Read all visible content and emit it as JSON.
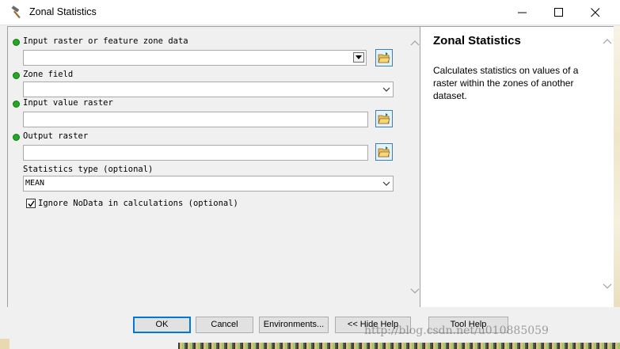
{
  "window": {
    "title": "Zonal Statistics",
    "icon": "hammer-icon"
  },
  "params": {
    "input_zone": {
      "label": "Input raster or feature zone data",
      "value": ""
    },
    "zone_field": {
      "label": "Zone field",
      "value": ""
    },
    "input_value": {
      "label": "Input value raster",
      "value": ""
    },
    "output_raster": {
      "label": "Output raster",
      "value": ""
    },
    "stats_type": {
      "label": "Statistics type (optional)",
      "value": "MEAN"
    },
    "ignore_nodata": {
      "label": "Ignore NoData in calculations (optional)",
      "checked": true
    }
  },
  "help": {
    "title": "Zonal Statistics",
    "description": "Calculates statistics on values of a raster within the zones of another dataset."
  },
  "buttons": {
    "ok": "OK",
    "cancel": "Cancel",
    "environments": "Environments...",
    "hide_help": "<< Hide Help",
    "tool_help": "Tool Help"
  },
  "watermark": "http://blog.csdn.net/u010885059",
  "colors": {
    "required_dot": "#23a823",
    "default_button_border": "#0078d7",
    "browse_border": "#3c7fb1"
  }
}
